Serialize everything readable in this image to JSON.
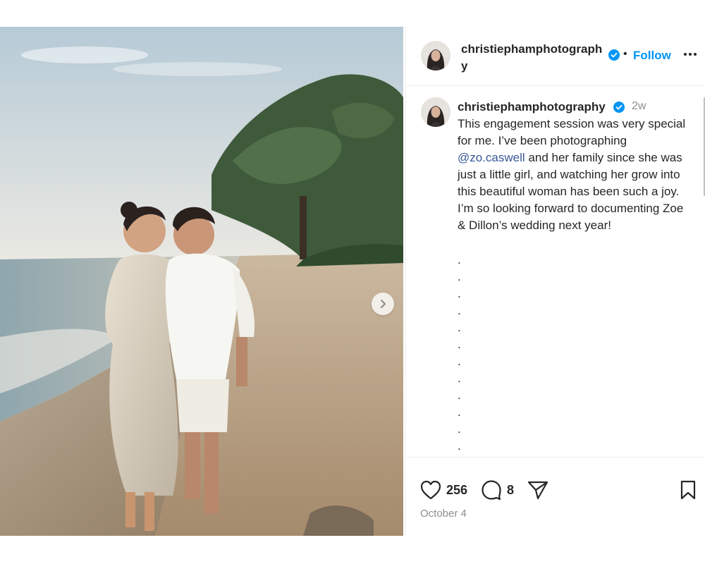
{
  "post": {
    "author": "christiephamphotography",
    "follow_label": "Follow",
    "dot_separator": "•",
    "time_ago": "2w",
    "caption": {
      "part1": "This  engagement session was very special for me. I’ve been photographing ",
      "mention": "@zo.caswell",
      "part2": " and her family since she was just a little girl, and watching her grow into this beautiful woman has been such a joy.  I’m so looking forward to documenting Zoe &  Dillon’s wedding next year!"
    },
    "dots": [
      ".",
      ".",
      ".",
      ".",
      ".",
      ".",
      ".",
      ".",
      ".",
      ".",
      ".",
      "."
    ],
    "likes": "256",
    "comments": "8",
    "date": "October 4"
  },
  "colors": {
    "follow_blue": "#0095f6",
    "verified_blue": "#0095f6",
    "mention_blue": "#385898",
    "muted_gray": "#8e8e8e"
  },
  "icons": [
    "chevron-right-icon",
    "verified-icon",
    "more-icon",
    "heart-icon",
    "comment-icon",
    "share-icon",
    "bookmark-icon"
  ]
}
